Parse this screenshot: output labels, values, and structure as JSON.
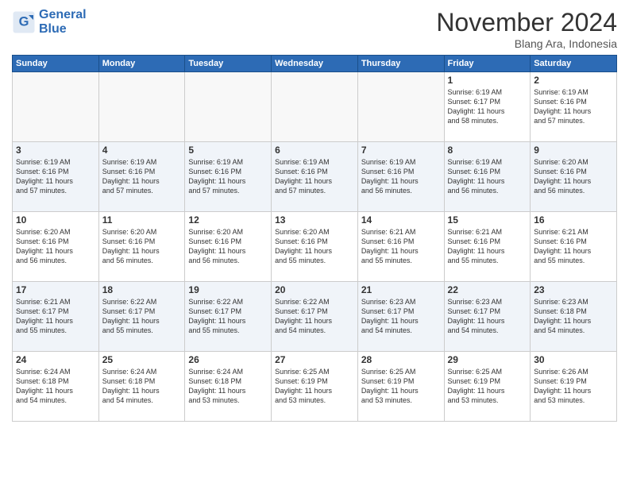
{
  "header": {
    "logo_line1": "General",
    "logo_line2": "Blue",
    "month_title": "November 2024",
    "location": "Blang Ara, Indonesia"
  },
  "weekdays": [
    "Sunday",
    "Monday",
    "Tuesday",
    "Wednesday",
    "Thursday",
    "Friday",
    "Saturday"
  ],
  "weeks": [
    [
      {
        "day": "",
        "info": ""
      },
      {
        "day": "",
        "info": ""
      },
      {
        "day": "",
        "info": ""
      },
      {
        "day": "",
        "info": ""
      },
      {
        "day": "",
        "info": ""
      },
      {
        "day": "1",
        "info": "Sunrise: 6:19 AM\nSunset: 6:17 PM\nDaylight: 11 hours\nand 58 minutes."
      },
      {
        "day": "2",
        "info": "Sunrise: 6:19 AM\nSunset: 6:16 PM\nDaylight: 11 hours\nand 57 minutes."
      }
    ],
    [
      {
        "day": "3",
        "info": "Sunrise: 6:19 AM\nSunset: 6:16 PM\nDaylight: 11 hours\nand 57 minutes."
      },
      {
        "day": "4",
        "info": "Sunrise: 6:19 AM\nSunset: 6:16 PM\nDaylight: 11 hours\nand 57 minutes."
      },
      {
        "day": "5",
        "info": "Sunrise: 6:19 AM\nSunset: 6:16 PM\nDaylight: 11 hours\nand 57 minutes."
      },
      {
        "day": "6",
        "info": "Sunrise: 6:19 AM\nSunset: 6:16 PM\nDaylight: 11 hours\nand 57 minutes."
      },
      {
        "day": "7",
        "info": "Sunrise: 6:19 AM\nSunset: 6:16 PM\nDaylight: 11 hours\nand 56 minutes."
      },
      {
        "day": "8",
        "info": "Sunrise: 6:19 AM\nSunset: 6:16 PM\nDaylight: 11 hours\nand 56 minutes."
      },
      {
        "day": "9",
        "info": "Sunrise: 6:20 AM\nSunset: 6:16 PM\nDaylight: 11 hours\nand 56 minutes."
      }
    ],
    [
      {
        "day": "10",
        "info": "Sunrise: 6:20 AM\nSunset: 6:16 PM\nDaylight: 11 hours\nand 56 minutes."
      },
      {
        "day": "11",
        "info": "Sunrise: 6:20 AM\nSunset: 6:16 PM\nDaylight: 11 hours\nand 56 minutes."
      },
      {
        "day": "12",
        "info": "Sunrise: 6:20 AM\nSunset: 6:16 PM\nDaylight: 11 hours\nand 56 minutes."
      },
      {
        "day": "13",
        "info": "Sunrise: 6:20 AM\nSunset: 6:16 PM\nDaylight: 11 hours\nand 55 minutes."
      },
      {
        "day": "14",
        "info": "Sunrise: 6:21 AM\nSunset: 6:16 PM\nDaylight: 11 hours\nand 55 minutes."
      },
      {
        "day": "15",
        "info": "Sunrise: 6:21 AM\nSunset: 6:16 PM\nDaylight: 11 hours\nand 55 minutes."
      },
      {
        "day": "16",
        "info": "Sunrise: 6:21 AM\nSunset: 6:16 PM\nDaylight: 11 hours\nand 55 minutes."
      }
    ],
    [
      {
        "day": "17",
        "info": "Sunrise: 6:21 AM\nSunset: 6:17 PM\nDaylight: 11 hours\nand 55 minutes."
      },
      {
        "day": "18",
        "info": "Sunrise: 6:22 AM\nSunset: 6:17 PM\nDaylight: 11 hours\nand 55 minutes."
      },
      {
        "day": "19",
        "info": "Sunrise: 6:22 AM\nSunset: 6:17 PM\nDaylight: 11 hours\nand 55 minutes."
      },
      {
        "day": "20",
        "info": "Sunrise: 6:22 AM\nSunset: 6:17 PM\nDaylight: 11 hours\nand 54 minutes."
      },
      {
        "day": "21",
        "info": "Sunrise: 6:23 AM\nSunset: 6:17 PM\nDaylight: 11 hours\nand 54 minutes."
      },
      {
        "day": "22",
        "info": "Sunrise: 6:23 AM\nSunset: 6:17 PM\nDaylight: 11 hours\nand 54 minutes."
      },
      {
        "day": "23",
        "info": "Sunrise: 6:23 AM\nSunset: 6:18 PM\nDaylight: 11 hours\nand 54 minutes."
      }
    ],
    [
      {
        "day": "24",
        "info": "Sunrise: 6:24 AM\nSunset: 6:18 PM\nDaylight: 11 hours\nand 54 minutes."
      },
      {
        "day": "25",
        "info": "Sunrise: 6:24 AM\nSunset: 6:18 PM\nDaylight: 11 hours\nand 54 minutes."
      },
      {
        "day": "26",
        "info": "Sunrise: 6:24 AM\nSunset: 6:18 PM\nDaylight: 11 hours\nand 53 minutes."
      },
      {
        "day": "27",
        "info": "Sunrise: 6:25 AM\nSunset: 6:19 PM\nDaylight: 11 hours\nand 53 minutes."
      },
      {
        "day": "28",
        "info": "Sunrise: 6:25 AM\nSunset: 6:19 PM\nDaylight: 11 hours\nand 53 minutes."
      },
      {
        "day": "29",
        "info": "Sunrise: 6:25 AM\nSunset: 6:19 PM\nDaylight: 11 hours\nand 53 minutes."
      },
      {
        "day": "30",
        "info": "Sunrise: 6:26 AM\nSunset: 6:19 PM\nDaylight: 11 hours\nand 53 minutes."
      }
    ]
  ]
}
